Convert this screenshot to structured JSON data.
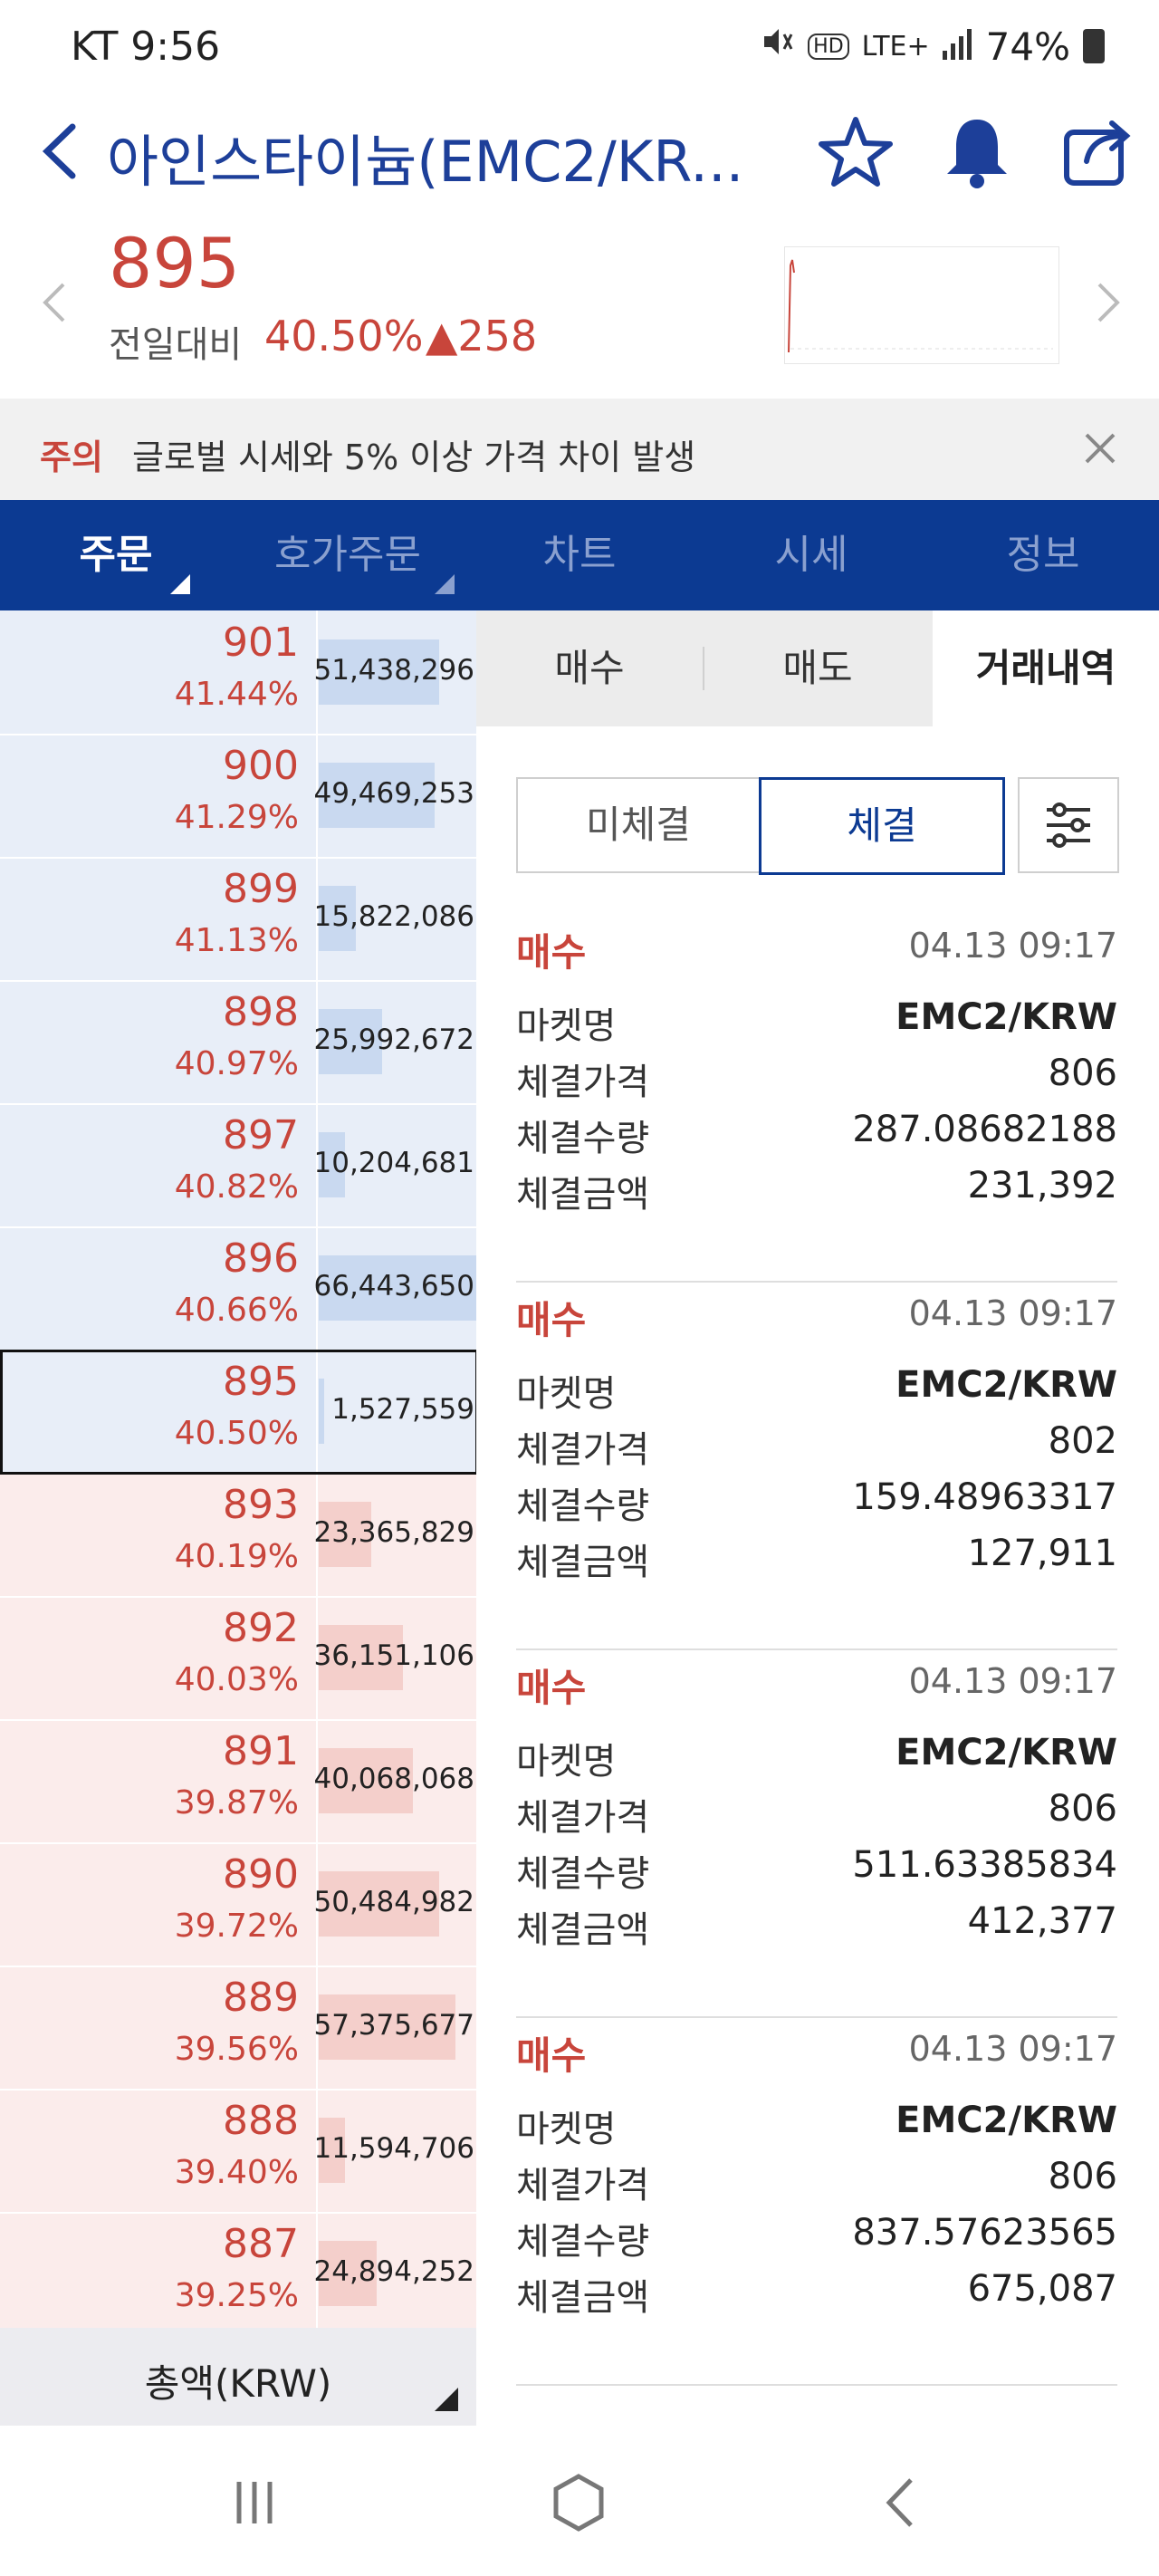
{
  "status_bar": {
    "carrier_time": "KT 9:56",
    "network": "LTE+",
    "battery": "74%",
    "icons": [
      "mute-icon",
      "hd-icon",
      "lte-icon",
      "signal-icon",
      "battery-icon"
    ]
  },
  "header": {
    "title": "아인스타이늄(EMC2/KR...",
    "icons": [
      "back-icon",
      "star-icon",
      "bell-icon",
      "share-icon"
    ]
  },
  "price": {
    "current": "895",
    "change_label": "전일대비",
    "change_pct": "40.50%",
    "change_amount": "▲258"
  },
  "warning": {
    "tag": "주의",
    "text": "글로벌 시세와 5% 이상 가격 차이 발생"
  },
  "tabs": [
    {
      "label": "주문"
    },
    {
      "label": "호가주문"
    },
    {
      "label": "차트"
    },
    {
      "label": "시세"
    },
    {
      "label": "정보"
    }
  ],
  "orderbook": {
    "rows": [
      {
        "price": "901",
        "pct": "41.44%",
        "qty": "51,438,296",
        "side": "ask",
        "fill": 0.23
      },
      {
        "price": "900",
        "pct": "41.29%",
        "qty": "49,469,253",
        "side": "ask",
        "fill": 0.22
      },
      {
        "price": "899",
        "pct": "41.13%",
        "qty": "15,822,086",
        "side": "ask",
        "fill": 0.07
      },
      {
        "price": "898",
        "pct": "40.97%",
        "qty": "25,992,672",
        "side": "ask",
        "fill": 0.12
      },
      {
        "price": "897",
        "pct": "40.82%",
        "qty": "10,204,681",
        "side": "ask",
        "fill": 0.05
      },
      {
        "price": "896",
        "pct": "40.66%",
        "qty": "66,443,650",
        "side": "ask",
        "fill": 0.3
      },
      {
        "price": "895",
        "pct": "40.50%",
        "qty": "1,527,559",
        "side": "ask",
        "fill": 0.01
      },
      {
        "price": "893",
        "pct": "40.19%",
        "qty": "23,365,829",
        "side": "bid",
        "fill": 0.1
      },
      {
        "price": "892",
        "pct": "40.03%",
        "qty": "36,151,106",
        "side": "bid",
        "fill": 0.16
      },
      {
        "price": "891",
        "pct": "39.87%",
        "qty": "40,068,068",
        "side": "bid",
        "fill": 0.18
      },
      {
        "price": "890",
        "pct": "39.72%",
        "qty": "50,484,982",
        "side": "bid",
        "fill": 0.23
      },
      {
        "price": "889",
        "pct": "39.56%",
        "qty": "57,375,677",
        "side": "bid",
        "fill": 0.26
      },
      {
        "price": "888",
        "pct": "39.40%",
        "qty": "11,594,706",
        "side": "bid",
        "fill": 0.05
      },
      {
        "price": "887",
        "pct": "39.25%",
        "qty": "24,894,252",
        "side": "bid",
        "fill": 0.11
      }
    ],
    "current_index": 6,
    "total_label": "총액(KRW)"
  },
  "order_panel": {
    "tabs": [
      "매수",
      "매도",
      "거래내역"
    ],
    "active_tab": 2,
    "filters": [
      "미체결",
      "체결"
    ],
    "active_filter": 1,
    "settings_icon": "sliders-icon",
    "labels": {
      "market": "마켓명",
      "price": "체결가격",
      "qty": "체결수량",
      "amount": "체결금액"
    },
    "trades": [
      {
        "type": "매수",
        "time": "04.13 09:17",
        "market": "EMC2/KRW",
        "price": "806",
        "qty": "287.08682188",
        "amount": "231,392"
      },
      {
        "type": "매수",
        "time": "04.13 09:17",
        "market": "EMC2/KRW",
        "price": "802",
        "qty": "159.48963317",
        "amount": "127,911"
      },
      {
        "type": "매수",
        "time": "04.13 09:17",
        "market": "EMC2/KRW",
        "price": "806",
        "qty": "511.63385834",
        "amount": "412,377"
      },
      {
        "type": "매수",
        "time": "04.13 09:17",
        "market": "EMC2/KRW",
        "price": "806",
        "qty": "837.57623565",
        "amount": "675,087"
      }
    ]
  },
  "colors": {
    "accent": "#0c3a92",
    "up": "#c8453b",
    "ask_bg": "#e8eef8",
    "bid_bg": "#fbeceb"
  },
  "navbar": {
    "icons": [
      "recent-apps-icon",
      "home-icon",
      "back-nav-icon"
    ]
  }
}
